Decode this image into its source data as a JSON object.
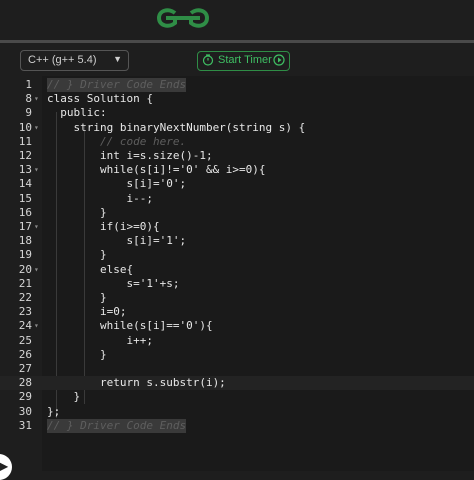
{
  "brand": {
    "logo_icon": "gfg-logo-icon",
    "color": "#2f8d46"
  },
  "toolbar": {
    "language": "C++ (g++ 5.4)",
    "timer_label": "Start Timer",
    "accent": "#2f8d46"
  },
  "editor": {
    "lines": [
      {
        "num": "1",
        "code": "// } Driver Code Ends"
      },
      {
        "num": "8",
        "code": "class Solution {"
      },
      {
        "num": "9",
        "code": "  public:"
      },
      {
        "num": "10",
        "code": "    string binaryNextNumber(string s) {"
      },
      {
        "num": "11",
        "code": "        // code here."
      },
      {
        "num": "12",
        "code": "        int i=s.size()-1;"
      },
      {
        "num": "13",
        "code": "        while(s[i]!='0' && i>=0){"
      },
      {
        "num": "14",
        "code": "            s[i]='0';"
      },
      {
        "num": "15",
        "code": "            i--;"
      },
      {
        "num": "16",
        "code": "        }"
      },
      {
        "num": "17",
        "code": "        if(i>=0){"
      },
      {
        "num": "18",
        "code": "            s[i]='1';"
      },
      {
        "num": "19",
        "code": "        }"
      },
      {
        "num": "20",
        "code": "        else{"
      },
      {
        "num": "21",
        "code": "            s='1'+s;"
      },
      {
        "num": "22",
        "code": "        }"
      },
      {
        "num": "23",
        "code": "        i=0;"
      },
      {
        "num": "24",
        "code": "        while(s[i]=='0'){"
      },
      {
        "num": "25",
        "code": "            i++;"
      },
      {
        "num": "26",
        "code": "        }"
      },
      {
        "num": "27",
        "code": ""
      },
      {
        "num": "28",
        "code": "        return s.substr(i);"
      },
      {
        "num": "29",
        "code": "    }"
      },
      {
        "num": "30",
        "code": "};"
      },
      {
        "num": "31",
        "code": "// } Driver Code Ends"
      }
    ],
    "collapsed_prefix": "⟷",
    "scroll_handle_icon": "▶"
  }
}
